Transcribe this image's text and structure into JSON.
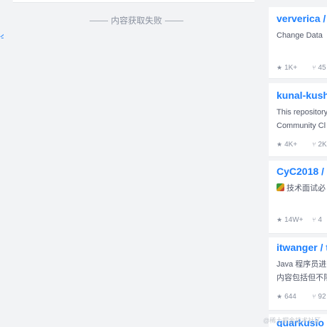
{
  "left": {
    "fail_message": "内容获取失败",
    "edge_link_text": "今"
  },
  "repos": [
    {
      "title": "ververica /",
      "desc_lines": [
        "Change Data"
      ],
      "stars": "1K+",
      "forks": "45"
    },
    {
      "title": "kunal-kush",
      "desc_lines": [
        "This repository",
        "Community Cl"
      ],
      "stars": "4K+",
      "forks": "2K"
    },
    {
      "title": "CyC2018 /",
      "desc_lines": [
        "技术面试必"
      ],
      "stars": "14W+",
      "forks": "4"
    },
    {
      "title": "itwanger / t",
      "desc_lines": [
        "Java 程序员进",
        "内容包括但不限"
      ],
      "stars": "644",
      "forks": "92"
    },
    {
      "title": "quarkusio",
      "desc_lines": [],
      "stars": "",
      "forks": ""
    }
  ],
  "icons": {
    "star": "star-icon",
    "fork": "fork-icon",
    "book": "books-emoji-icon"
  },
  "colors": {
    "link": "#1e80ff",
    "muted": "#8a919f",
    "text": "#515767",
    "background": "#f2f3f5"
  },
  "watermark": "@稀土掘金技术社区"
}
